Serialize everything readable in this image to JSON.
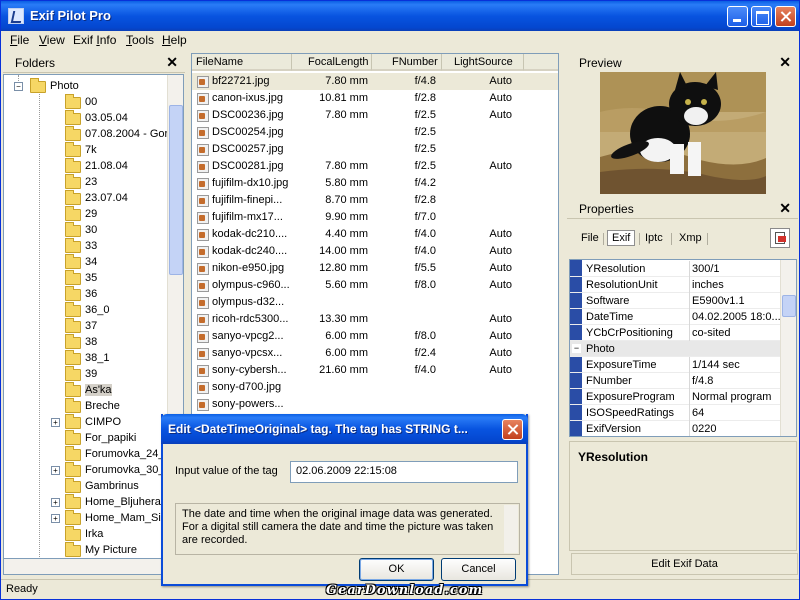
{
  "window": {
    "title": "Exif Pilot Pro"
  },
  "menu": [
    {
      "pre": "",
      "u": "F",
      "post": "ile"
    },
    {
      "pre": "",
      "u": "V",
      "post": "iew"
    },
    {
      "pre": "Exif ",
      "u": "I",
      "post": "nfo"
    },
    {
      "pre": "",
      "u": "T",
      "post": "ools"
    },
    {
      "pre": "",
      "u": "H",
      "post": "elp"
    }
  ],
  "folders_panel": {
    "title": "Folders",
    "root": "Photo",
    "items": [
      {
        "label": "00",
        "expandable": false
      },
      {
        "label": "03.05.04",
        "expandable": false
      },
      {
        "label": "07.08.2004 - Gor",
        "expandable": false
      },
      {
        "label": "7k",
        "expandable": false
      },
      {
        "label": "21.08.04",
        "expandable": false
      },
      {
        "label": "23",
        "expandable": false
      },
      {
        "label": "23.07.04",
        "expandable": false
      },
      {
        "label": "29",
        "expandable": false
      },
      {
        "label": "30",
        "expandable": false
      },
      {
        "label": "33",
        "expandable": false
      },
      {
        "label": "34",
        "expandable": false
      },
      {
        "label": "35",
        "expandable": false
      },
      {
        "label": "36",
        "expandable": false
      },
      {
        "label": "36_0",
        "expandable": false
      },
      {
        "label": "37",
        "expandable": false
      },
      {
        "label": "38",
        "expandable": false
      },
      {
        "label": "38_1",
        "expandable": false
      },
      {
        "label": "39",
        "expandable": false
      },
      {
        "label": "As'ka",
        "expandable": false,
        "selected": true
      },
      {
        "label": "Breche",
        "expandable": false
      },
      {
        "label": "CIMPO",
        "expandable": true
      },
      {
        "label": "For_papiki",
        "expandable": false
      },
      {
        "label": "Forumovka_24_",
        "expandable": false
      },
      {
        "label": "Forumovka_30_",
        "expandable": true
      },
      {
        "label": "Gambrinus",
        "expandable": false
      },
      {
        "label": "Home_Bljuhera",
        "expandable": true
      },
      {
        "label": "Home_Mam_Sib",
        "expandable": true
      },
      {
        "label": "Irka",
        "expandable": false
      },
      {
        "label": "My Picture",
        "expandable": false
      }
    ]
  },
  "file_list": {
    "columns": [
      "FileName",
      "FocalLength",
      "FNumber",
      "LightSource"
    ],
    "rows": [
      {
        "name": "bf22721.jpg",
        "focal": "7.80 mm",
        "fnum": "f/4.8",
        "light": "Auto",
        "selected": true
      },
      {
        "name": "canon-ixus.jpg",
        "focal": "10.81 mm",
        "fnum": "f/2.8",
        "light": "Auto"
      },
      {
        "name": "DSC00236.jpg",
        "focal": "7.80 mm",
        "fnum": "f/2.5",
        "light": "Auto"
      },
      {
        "name": "DSC00254.jpg",
        "focal": "",
        "fnum": "f/2.5",
        "light": ""
      },
      {
        "name": "DSC00257.jpg",
        "focal": "",
        "fnum": "f/2.5",
        "light": ""
      },
      {
        "name": "DSC00281.jpg",
        "focal": "7.80 mm",
        "fnum": "f/2.5",
        "light": "Auto"
      },
      {
        "name": "fujifilm-dx10.jpg",
        "focal": "5.80 mm",
        "fnum": "f/4.2",
        "light": ""
      },
      {
        "name": "fujifilm-finepi...",
        "focal": "8.70 mm",
        "fnum": "f/2.8",
        "light": ""
      },
      {
        "name": "fujifilm-mx17...",
        "focal": "9.90 mm",
        "fnum": "f/7.0",
        "light": ""
      },
      {
        "name": "kodak-dc210....",
        "focal": "4.40 mm",
        "fnum": "f/4.0",
        "light": "Auto"
      },
      {
        "name": "kodak-dc240....",
        "focal": "14.00 mm",
        "fnum": "f/4.0",
        "light": "Auto"
      },
      {
        "name": "nikon-e950.jpg",
        "focal": "12.80 mm",
        "fnum": "f/5.5",
        "light": "Auto"
      },
      {
        "name": "olympus-c960...",
        "focal": "5.60 mm",
        "fnum": "f/8.0",
        "light": "Auto"
      },
      {
        "name": "olympus-d32...",
        "focal": "",
        "fnum": "",
        "light": ""
      },
      {
        "name": "ricoh-rdc5300...",
        "focal": "13.30 mm",
        "fnum": "",
        "light": "Auto"
      },
      {
        "name": "sanyo-vpcg2...",
        "focal": "6.00 mm",
        "fnum": "f/8.0",
        "light": "Auto"
      },
      {
        "name": "sanyo-vpcsx...",
        "focal": "6.00 mm",
        "fnum": "f/2.4",
        "light": "Auto"
      },
      {
        "name": "sony-cybersh...",
        "focal": "21.60 mm",
        "fnum": "f/4.0",
        "light": "Auto"
      },
      {
        "name": "sony-d700.jpg",
        "focal": "",
        "fnum": "",
        "light": ""
      },
      {
        "name": "sony-powers...",
        "focal": "",
        "fnum": "",
        "light": ""
      }
    ]
  },
  "preview_panel": {
    "title": "Preview"
  },
  "properties_panel": {
    "title": "Properties",
    "tabs": [
      "File",
      "Exif",
      "Iptc",
      "Xmp"
    ],
    "active_tab": "Exif",
    "rows": [
      {
        "name": "YResolution",
        "value": "300/1"
      },
      {
        "name": "ResolutionUnit",
        "value": "inches"
      },
      {
        "name": "Software",
        "value": "E5900v1.1"
      },
      {
        "name": "DateTime",
        "value": "04.02.2005 18:0..."
      },
      {
        "name": "YCbCrPositioning",
        "value": "co-sited"
      },
      {
        "name": "Photo",
        "value": "",
        "category": true
      },
      {
        "name": "ExposureTime",
        "value": "1/144 sec"
      },
      {
        "name": "FNumber",
        "value": "f/4.8"
      },
      {
        "name": "ExposureProgram",
        "value": "Normal program"
      },
      {
        "name": "ISOSpeedRatings",
        "value": "64"
      },
      {
        "name": "ExifVersion",
        "value": "0220"
      }
    ],
    "description_title": "YResolution",
    "edit_button": "Edit Exif Data"
  },
  "status": {
    "text": "Ready"
  },
  "dialog": {
    "title": "Edit <DateTimeOriginal> tag. The tag has STRING t...",
    "input_label": "Input value of the tag",
    "input_value": "02.06.2009 22:15:08",
    "description": "The date and time when the original image data was generated. For a digital still camera the date and time the picture was taken are recorded.",
    "ok_label": "OK",
    "cancel_label": "Cancel"
  },
  "watermark": "GearDownload.com"
}
